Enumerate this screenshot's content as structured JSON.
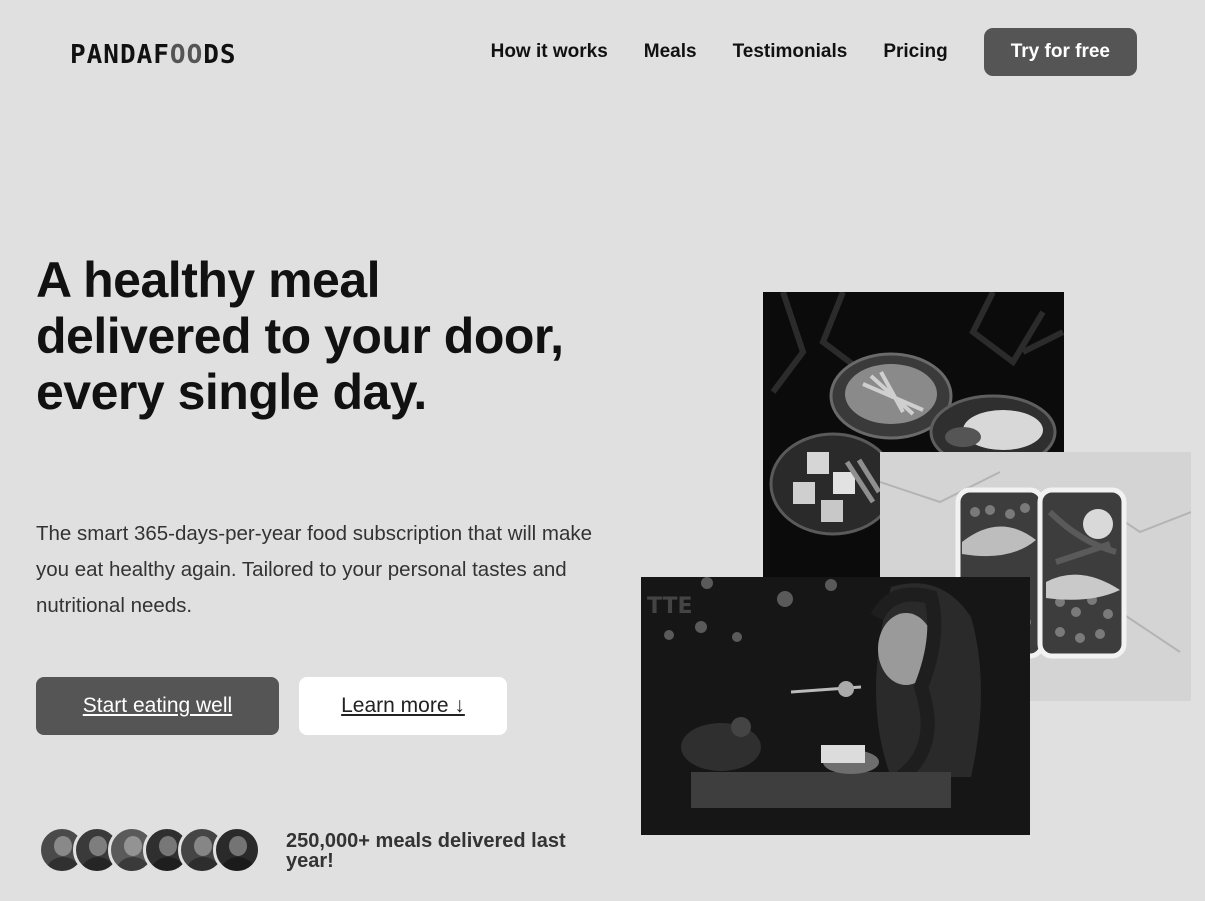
{
  "brand": {
    "logo_start": "PANDAF",
    "logo_oo": "OO",
    "logo_end": "DS"
  },
  "nav": {
    "links": [
      "How it works",
      "Meals",
      "Testimonials",
      "Pricing"
    ],
    "cta": "Try for free"
  },
  "hero": {
    "title": "A healthy meal delivered to your door, every single day.",
    "subtitle": "The smart 365-days-per-year food subscription that will make you eat healthy again. Tailored to your personal tastes and nutritional needs.",
    "primary_button": "Start eating well",
    "secondary_button": "Learn more ↓"
  },
  "social_proof": {
    "text": "250,000+ meals delivered last year!",
    "avatar_colors": [
      "#4a4a4a",
      "#3a3a3a",
      "#5a5a5a",
      "#2f2f2f",
      "#454545",
      "#2a2a2a"
    ]
  },
  "images": [
    {
      "name": "bowls-photo",
      "tone": "#0b0b0b"
    },
    {
      "name": "lunchbox-photo",
      "tone": "#d4d4d4"
    },
    {
      "name": "woman-eating-photo",
      "tone": "#161616"
    }
  ]
}
